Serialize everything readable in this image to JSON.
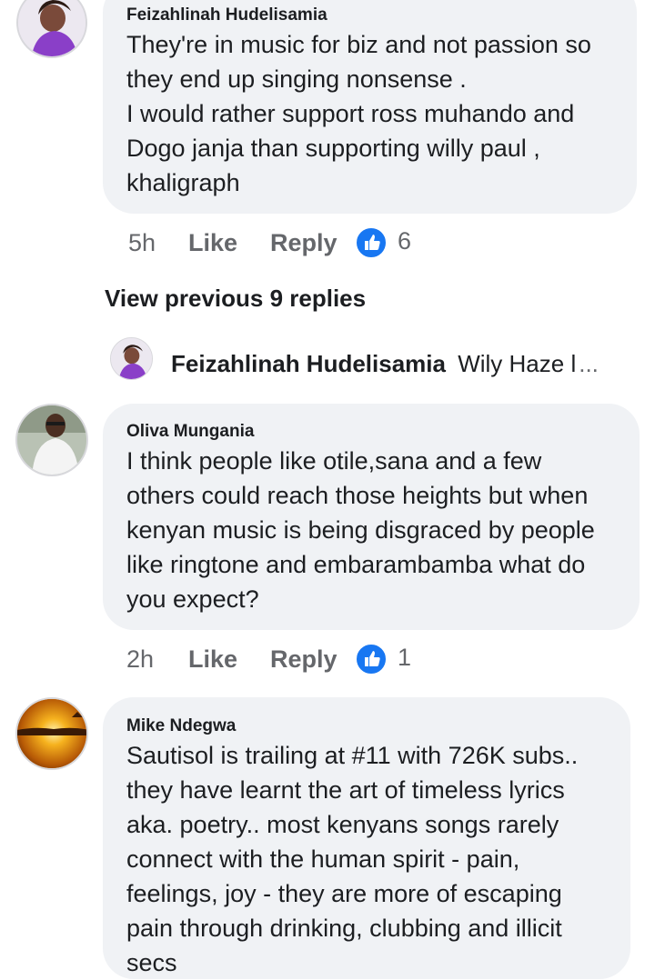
{
  "colors": {
    "bubble": "#f0f2f5",
    "meta_text": "#65676b",
    "like_blue": "#1877f2",
    "text": "#1c1e21"
  },
  "comments": [
    {
      "author": "Feizahlinah Hudelisamia",
      "text": "They're in music for biz and not passion so\nthey end up singing nonsense .\nI would rather support ross muhando and\nDogo janja than supporting willy paul ,\nkhaligraph",
      "time": "5h",
      "like_label": "Like",
      "reply_label": "Reply",
      "reaction_icon": "thumbs-up-icon",
      "reaction_count": "6"
    },
    {
      "author": "Oliva Mungania",
      "text": "I think people like otile,sana and a few\nothers could reach those heights but when\nkenyan music is being disgraced by people\nlike ringtone and embarambamba what do\nyou expect?",
      "time": "2h",
      "like_label": "Like",
      "reply_label": "Reply",
      "reaction_icon": "thumbs-up-icon",
      "reaction_count": "1"
    },
    {
      "author": "Mike Ndegwa",
      "text": "Sautisol is trailing at #11 with 726K subs..\nthey have learnt the art of timeless lyrics\naka. poetry..  most kenyans songs rarely\nconnect with the human spirit - pain,\nfeelings, joy - they are more of escaping\npain through drinking, clubbing and illicit\nsecs"
    }
  ],
  "view_previous": "View previous 9 replies",
  "reply_preview": {
    "author": "Feizahlinah Hudelisamia",
    "snippet": "Wily Haze l",
    "ellipsis": "..."
  }
}
